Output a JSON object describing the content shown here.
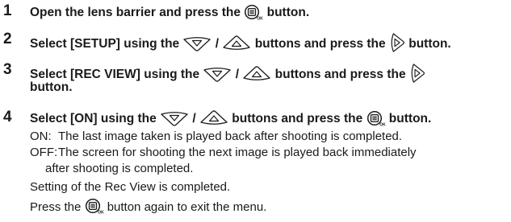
{
  "steps": [
    {
      "number": "1",
      "text_a": "Open the lens barrier and press the ",
      "text_b": " button."
    },
    {
      "number": "2",
      "text_a": "Select [SETUP] using the ",
      "text_sep": " / ",
      "text_b": " buttons and press the ",
      "text_c": " button."
    },
    {
      "number": "3",
      "text_a": "Select [REC VIEW] using the ",
      "text_sep": " / ",
      "text_b": " buttons and press the ",
      "text_line2": "button."
    },
    {
      "number": "4",
      "text_a": "Select [ON] using the ",
      "text_sep": " / ",
      "text_b": " buttons and press the ",
      "text_c": " button."
    }
  ],
  "options": [
    {
      "key": "ON:",
      "desc": "The last image taken is played back after shooting is completed."
    },
    {
      "key": "OFF:",
      "desc": "The screen for shooting the next image is played back immediately",
      "desc_cont": "after shooting is completed."
    }
  ],
  "note_completed": "Setting of the Rec View is completed.",
  "note_exit_a": "Press the ",
  "note_exit_b": " button again to exit the menu.",
  "icons": {
    "ok_button": "menu-ok-button-icon",
    "down_arrow": "down-arrow-button-icon",
    "up_arrow": "up-arrow-button-icon",
    "right_arrow": "right-arrow-button-icon"
  },
  "colors": {
    "text": "#1a1a1a",
    "background": "#ffffff"
  }
}
